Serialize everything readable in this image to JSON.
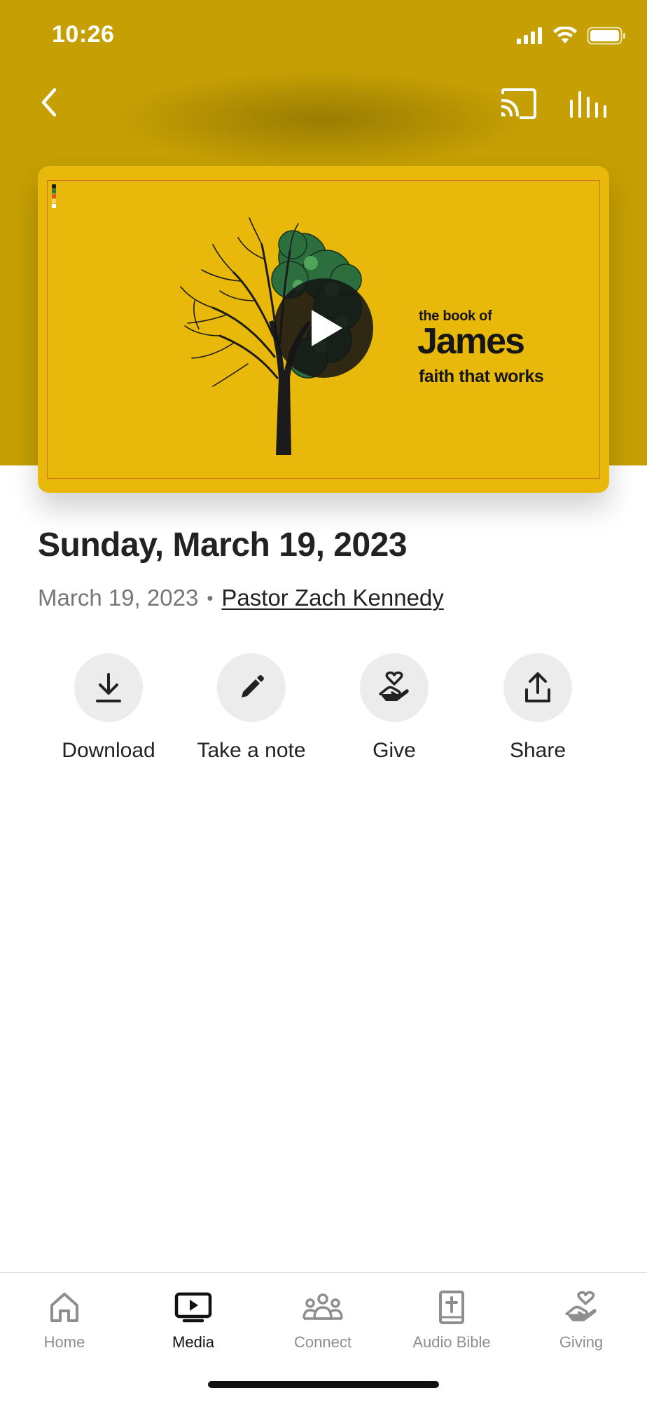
{
  "status_bar": {
    "time": "10:26"
  },
  "nav": {
    "back_icon": "chevron-left-icon",
    "cast_icon": "cast-icon",
    "audio_icon": "audio-bars-icon"
  },
  "video": {
    "series_prefix": "the book of",
    "series_title": "James",
    "series_subtitle": "faith that works",
    "play_icon": "play-icon",
    "background_color": "#e8b90a"
  },
  "sermon": {
    "title": "Sunday, March 19, 2023",
    "date": "March 19, 2023",
    "separator": "•",
    "speaker": "Pastor Zach Kennedy"
  },
  "actions": [
    {
      "label": "Download",
      "icon": "download-icon"
    },
    {
      "label": "Take a note",
      "icon": "pencil-icon"
    },
    {
      "label": "Give",
      "icon": "heart-hand-icon"
    },
    {
      "label": "Share",
      "icon": "share-icon"
    }
  ],
  "tabs": [
    {
      "label": "Home",
      "icon": "home-icon",
      "active": false
    },
    {
      "label": "Media",
      "icon": "tv-play-icon",
      "active": true
    },
    {
      "label": "Connect",
      "icon": "people-icon",
      "active": false
    },
    {
      "label": "Audio Bible",
      "icon": "bible-icon",
      "active": false
    },
    {
      "label": "Giving",
      "icon": "heart-hand-icon",
      "active": false
    }
  ],
  "colors": {
    "header_background": "#c59f03",
    "accent_text": "#222222",
    "inactive_tab": "#8e8e8e"
  }
}
